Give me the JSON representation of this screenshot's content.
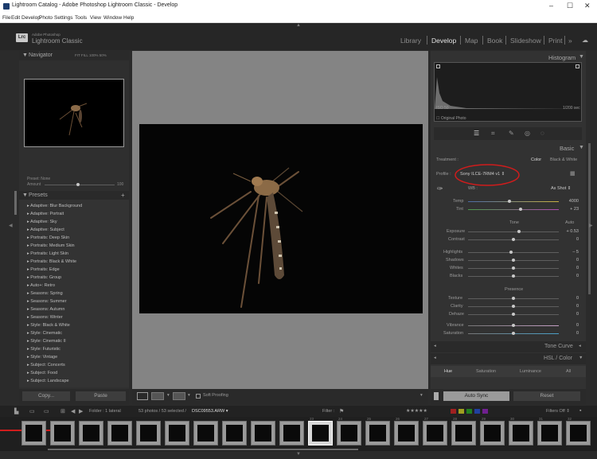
{
  "window": {
    "title": "Lightroom Catalog - Adobe Photoshop Lightroom Classic - Develop",
    "minimize": "–",
    "maximize": "☐",
    "close": "✕"
  },
  "menu": [
    "File",
    "Edit",
    "Develop",
    "Photo",
    "Settings",
    "Tools",
    "View",
    "Window",
    "Help"
  ],
  "identity": {
    "badge": "Lrc",
    "adobe": "Adobe Photoshop",
    "product": "Lightroom Classic"
  },
  "modules": [
    "Library",
    "Develop",
    "Map",
    "Book",
    "Slideshow",
    "Print",
    "»"
  ],
  "left": {
    "navigator": "Navigator",
    "nav_zoom": "FIT  FILL  100%  50%",
    "preset_label": "Preset:  None",
    "amount_label": "Amount",
    "amount_val": "100",
    "presets_title": "Presets",
    "presets": [
      "Adaptive: Blur Background",
      "Adaptive: Portrait",
      "Adaptive: Sky",
      "Adaptive: Subject",
      "Portraits: Deep Skin",
      "Portraits: Medium Skin",
      "Portraits: Light Skin",
      "Portraits: Black & White",
      "Portraits: Edge",
      "Portraits: Group",
      "Auto+: Retro",
      "Seasons: Spring",
      "Seasons: Summer",
      "Seasons: Autumn",
      "Seasons: Winter",
      "Style: Black & White",
      "Style: Cinematic",
      "Style: Cinematic II",
      "Style: Futuristic",
      "Style: Vintage",
      "Subject: Concerts",
      "Subject: Food",
      "Subject: Landscape"
    ],
    "copy": "Copy...",
    "paste": "Paste"
  },
  "right": {
    "histogram": "Histogram",
    "iso": "ISO 50",
    "shutter": "1/200 sec",
    "original": "Original Photo",
    "basic": "Basic",
    "treatment": "Treatment :",
    "color": "Color",
    "bw": "Black & White",
    "profile_label": "Profile :",
    "profile_value": "Sony ILCE-7RM4 v1",
    "wb_label": "WB :",
    "wb_value": "As Shot",
    "temp_label": "Temp",
    "temp_val": "4000",
    "tint_label": "Tint",
    "tint_val": "+ 23",
    "tone": "Tone",
    "auto": "Auto",
    "exposure_label": "Exposure",
    "exposure_val": "+ 0.53",
    "contrast_label": "Contrast",
    "contrast_val": "0",
    "highlights_label": "Highlights",
    "highlights_val": "– 5",
    "shadows_label": "Shadows",
    "shadows_val": "0",
    "whites_label": "Whites",
    "whites_val": "0",
    "blacks_label": "Blacks",
    "blacks_val": "0",
    "presence": "Presence",
    "texture_label": "Texture",
    "texture_val": "0",
    "clarity_label": "Clarity",
    "clarity_val": "0",
    "dehaze_label": "Dehaze",
    "dehaze_val": "0",
    "vibrance_label": "Vibrance",
    "vibrance_val": "0",
    "saturation_label": "Saturation",
    "saturation_val": "0",
    "tone_curve": "Tone Curve",
    "hsl": "HSL / Color",
    "hue": "Hue",
    "hsl_saturation": "Saturation",
    "luminance": "Luminance",
    "all": "All",
    "auto_sync": "Auto Sync",
    "reset": "Reset"
  },
  "toolbar": {
    "soft_proofing": "Soft Proofing"
  },
  "filmbar": {
    "folder": "Folder : 1 lateral",
    "count": "53 photos / 53 selected /",
    "filename": "DSC09553.ARW",
    "filter": "Filter :",
    "filters_off": "Filters Off"
  },
  "filmstrip": {
    "numbers": [
      "",
      "",
      "",
      "",
      "",
      "",
      "",
      "",
      "",
      "",
      "23",
      "24",
      "25",
      "26",
      "27",
      "28",
      "29",
      "30",
      "31",
      "32"
    ]
  },
  "colors": {
    "accent_red": "#d01c1c",
    "active_module": "#e2e2e2"
  }
}
